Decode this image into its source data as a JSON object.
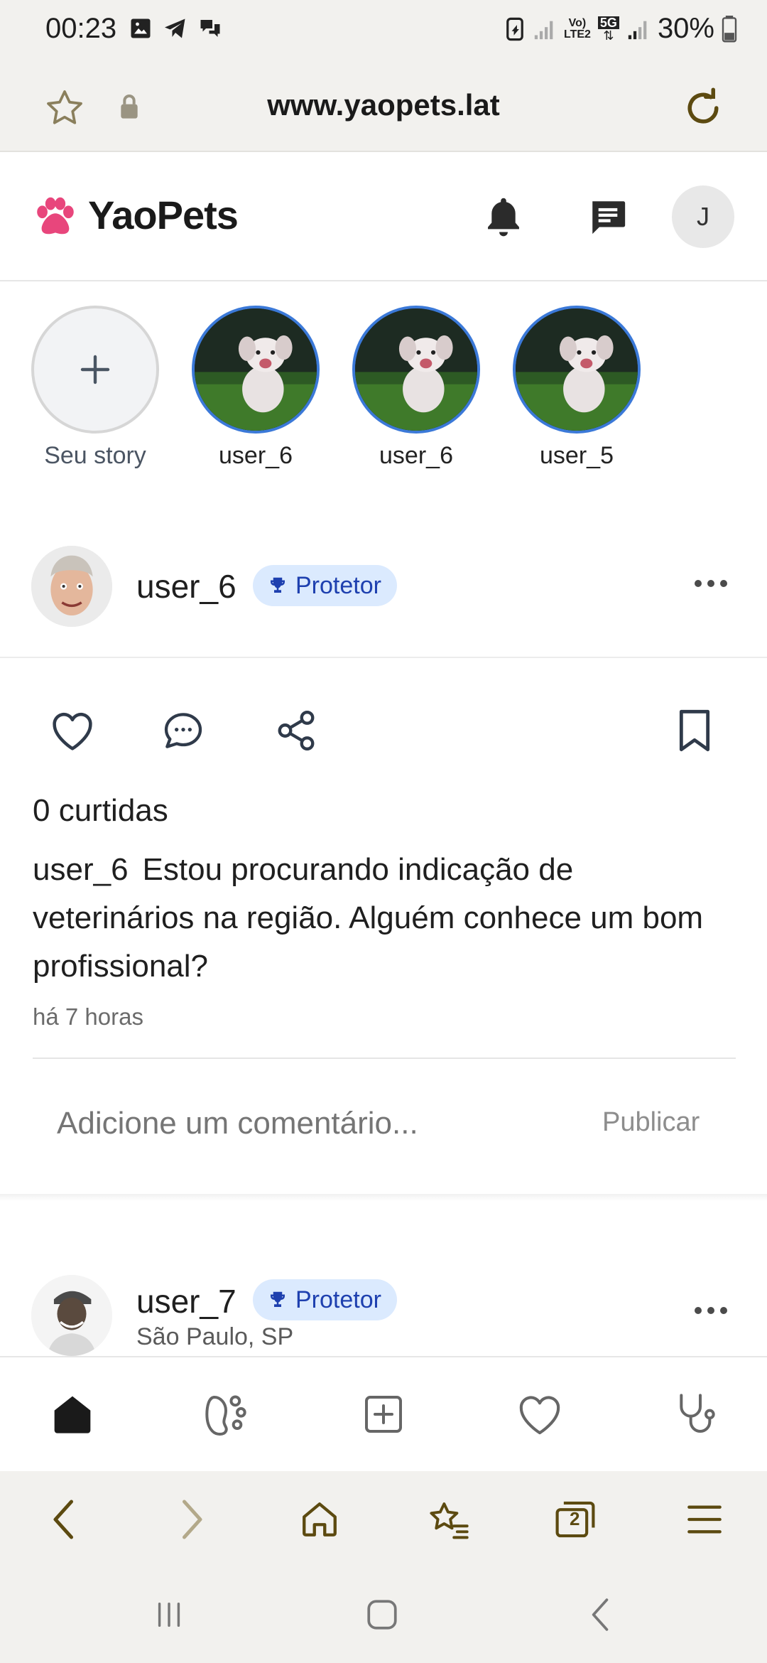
{
  "status_bar": {
    "time": "00:23",
    "battery": "30%",
    "net_label_1": "Vo)",
    "net_label_2": "LTE2",
    "net_label_3": "5G"
  },
  "browser": {
    "url": "www.yaopets.lat"
  },
  "app": {
    "brand": "YaoPets",
    "brand_color": "#e8467c",
    "avatar_initial": "J"
  },
  "stories": [
    {
      "label": "Seu story"
    },
    {
      "label": "user_6"
    },
    {
      "label": "user_6"
    },
    {
      "label": "user_5"
    }
  ],
  "post1": {
    "username": "user_6",
    "badge": "Protetor",
    "likes": "0 curtidas",
    "caption_user": "user_6",
    "caption_text": "Estou procurando indicação de veterinários na região. Alguém conhece um bom profissional?",
    "time": "há 7 horas",
    "comment_placeholder": "Adicione um comentário...",
    "publish_label": "Publicar"
  },
  "post2": {
    "username": "user_7",
    "badge": "Protetor",
    "location": "São Paulo, SP"
  },
  "bottom_nav": [
    "home-icon",
    "paw-icon",
    "add-post-icon",
    "heart-icon",
    "stethoscope-icon"
  ],
  "browser_bar": {
    "tab_count": "2"
  }
}
